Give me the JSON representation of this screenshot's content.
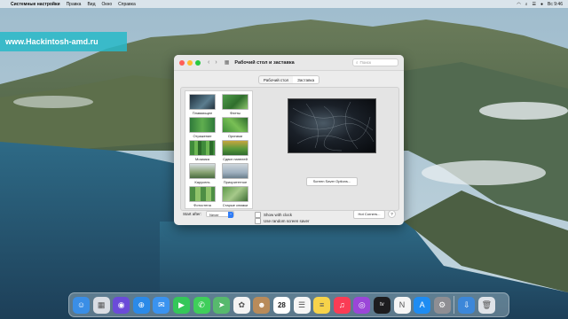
{
  "menubar": {
    "app_name": "Системные настройки",
    "items": [
      "Правка",
      "Вид",
      "Окно",
      "Справка"
    ],
    "clock": "Вс 9:46"
  },
  "watermark": "www.Hackintosh-amd.ru",
  "window": {
    "title": "Рабочий стол и заставка",
    "search_placeholder": "Поиск",
    "tabs": [
      {
        "label": "Рабочий стол",
        "active": false
      },
      {
        "label": "Заставка",
        "active": true
      }
    ],
    "screensavers": [
      {
        "label": "Плавающее"
      },
      {
        "label": "Флеты"
      },
      {
        "label": "Отражение"
      },
      {
        "label": "Оригами"
      },
      {
        "label": "Мозаика"
      },
      {
        "label": "Сдвиг панелей"
      },
      {
        "label": "Карусель"
      },
      {
        "label": "Приоритетное"
      },
      {
        "label": "Фотостена"
      },
      {
        "label": "Старые снимки"
      }
    ],
    "screen_saver_options": "Screen Saver Options...",
    "start_after_label": "Start after:",
    "start_after_value": "Never",
    "show_with_clock": "Show with clock",
    "use_random": "Use random screen saver",
    "hot_corners": "Hot Corners...",
    "help": "?"
  },
  "dock": {
    "apps": [
      {
        "icon": "finder-icon",
        "color": "#3a8ee6"
      },
      {
        "icon": "launchpad-icon",
        "color": "#d9dde3"
      },
      {
        "icon": "siri-icon",
        "color": "#6b4bd8"
      },
      {
        "icon": "safari-icon",
        "color": "#2b8ae8"
      },
      {
        "icon": "mail-icon",
        "color": "#3a93f0"
      },
      {
        "icon": "facetime-icon",
        "color": "#34c759"
      },
      {
        "icon": "messages-icon",
        "color": "#3fce5a"
      },
      {
        "icon": "maps-icon",
        "color": "#57b96d"
      },
      {
        "icon": "photos-icon",
        "color": "#f3f3f3"
      },
      {
        "icon": "contacts-icon",
        "color": "#b88b5a"
      },
      {
        "icon": "calendar-icon",
        "color": "#ffffff"
      },
      {
        "icon": "reminders-icon",
        "color": "#f5f5f5"
      },
      {
        "icon": "notes-icon",
        "color": "#f7d34a"
      },
      {
        "icon": "music-icon",
        "color": "#fa3c55"
      },
      {
        "icon": "podcasts-icon",
        "color": "#9b46d8"
      },
      {
        "icon": "apple-tv-icon",
        "color": "#1d1d1f"
      },
      {
        "icon": "news-icon",
        "color": "#f5f5f5"
      },
      {
        "icon": "app-store-icon",
        "color": "#1e8cf2"
      },
      {
        "icon": "system-preferences-icon",
        "color": "#8e8e93"
      }
    ],
    "calendar_day": "28",
    "right_items": [
      {
        "icon": "downloads-icon",
        "color": "#3c87d9"
      },
      {
        "icon": "trash-icon",
        "color": "#dfe3e8"
      }
    ]
  }
}
